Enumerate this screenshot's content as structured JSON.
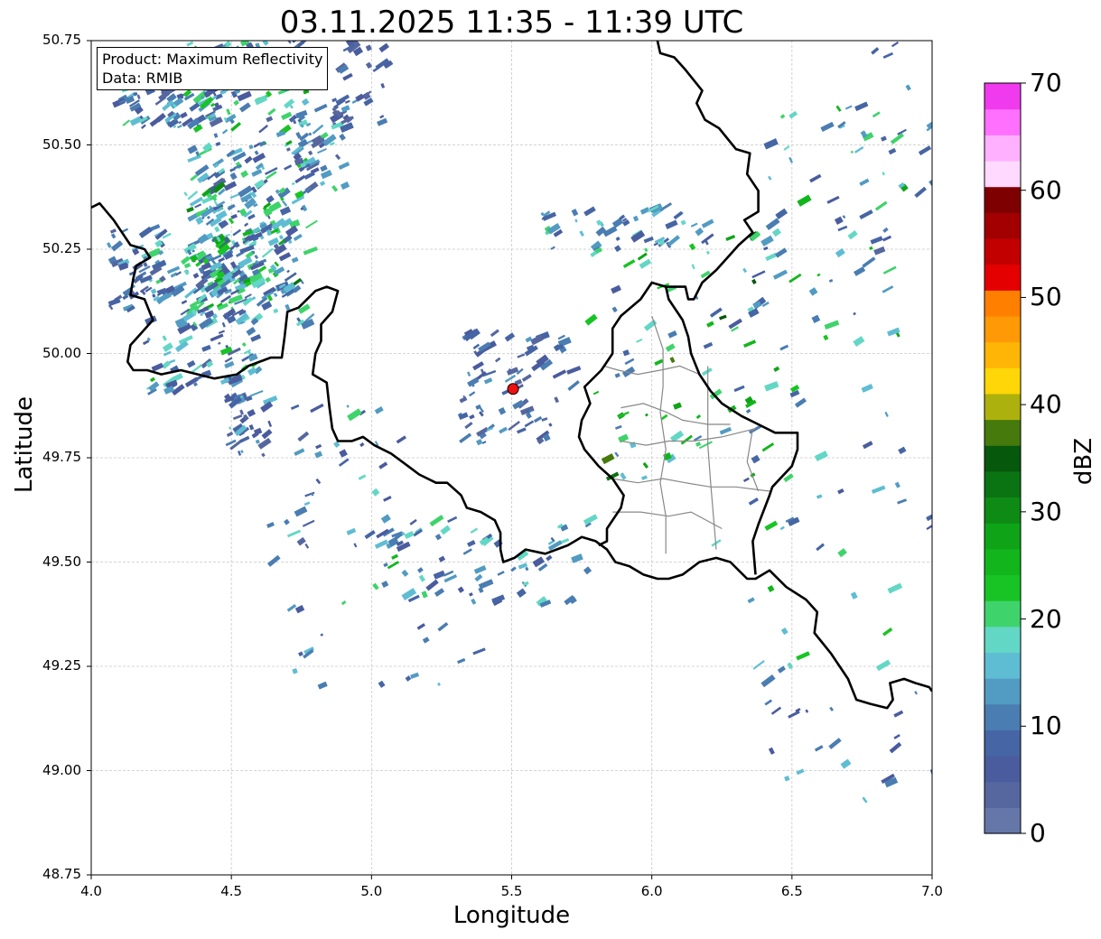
{
  "title": "03.11.2025 11:35 - 11:39 UTC",
  "info_box": {
    "product": "Product: Maximum Reflectivity",
    "source": "Data: RMIB"
  },
  "axes": {
    "xlabel": "Longitude",
    "ylabel": "Latitude",
    "xlim": [
      4.0,
      7.0
    ],
    "ylim": [
      48.75,
      50.75
    ],
    "xticks": [
      "4.0",
      "4.5",
      "5.0",
      "5.5",
      "6.0",
      "6.5",
      "7.0"
    ],
    "yticks": [
      "48.75",
      "49.00",
      "49.25",
      "49.50",
      "49.75",
      "50.00",
      "50.25",
      "50.50",
      "50.75"
    ],
    "grid": true
  },
  "colorbar": {
    "label": "dBZ",
    "range": [
      0,
      70
    ],
    "ticks": [
      "0",
      "10",
      "20",
      "30",
      "40",
      "50",
      "60",
      "70"
    ],
    "colors": [
      "#6577a8",
      "#56679f",
      "#4a5c9e",
      "#4665a4",
      "#4a7db1",
      "#529bc2",
      "#5fbdd3",
      "#63d7c5",
      "#3fd36b",
      "#18c424",
      "#12b61c",
      "#0fa418",
      "#0e8b15",
      "#0a7412",
      "#06580c",
      "#467a0c",
      "#adb10d",
      "#ffd607",
      "#ffb505",
      "#ff9906",
      "#ff7f00",
      "#e40000",
      "#c30000",
      "#a20000",
      "#7f0000",
      "#ffd9ff",
      "#ffb1ff",
      "#ff70ff",
      "#f03aee"
    ]
  },
  "radar_site": {
    "name": "radar-site",
    "lon": 5.505,
    "lat": 49.915,
    "color": "#ee1111"
  },
  "overlays": {
    "border_color": "#000000",
    "province_color": "#888888"
  }
}
